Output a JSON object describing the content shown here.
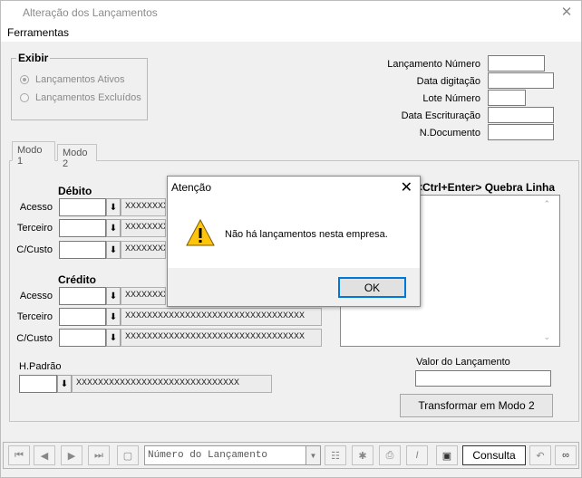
{
  "window": {
    "title": "Alteração dos Lançamentos",
    "close_glyph": "✕"
  },
  "menu": {
    "items": [
      "Ferramentas"
    ]
  },
  "exibir": {
    "legend": "Exibir",
    "options": [
      {
        "label": "Lançamentos Ativos",
        "checked": true
      },
      {
        "label": "Lançamentos Excluídos",
        "checked": false
      }
    ]
  },
  "header_fields": {
    "lancamento_numero": {
      "label": "Lançamento Número",
      "value": ""
    },
    "data_digitacao": {
      "label": "Data digitação",
      "value": ""
    },
    "lote_numero": {
      "label": "Lote Número",
      "value": ""
    },
    "data_escrituracao": {
      "label": "Data Escrituração",
      "value": ""
    },
    "n_documento": {
      "label": "N.Documento",
      "value": ""
    }
  },
  "tabs": [
    {
      "label": "Modo 1"
    },
    {
      "label": "Modo 2"
    }
  ],
  "debito": {
    "title": "Débito",
    "rows": [
      {
        "label": "Acesso",
        "text": "XXXXXXXXX"
      },
      {
        "label": "Terceiro",
        "text": "XXXXXXXXX"
      },
      {
        "label": "C/Custo",
        "text": "XXXXXXXXX"
      }
    ]
  },
  "credito": {
    "title": "Crédito",
    "rows": [
      {
        "label": "Acesso",
        "text": "XXXXXXXXX"
      },
      {
        "label": "Terceiro",
        "text": "XXXXXXXXXXXXXXXXXXXXXXXXXXXXXXXXX"
      },
      {
        "label": "C/Custo",
        "text": "XXXXXXXXXXXXXXXXXXXXXXXXXXXXXXXXX"
      }
    ]
  },
  "historico": {
    "hint": "<Ctrl+Enter> Quebra Linha"
  },
  "h_padrao": {
    "label": "H.Padrão",
    "text": "XXXXXXXXXXXXXXXXXXXXXXXXXXXXXX"
  },
  "valor": {
    "label": "Valor do Lançamento",
    "value": ""
  },
  "transform_button": "Transformar em  Modo 2",
  "toolbar": {
    "search_placeholder": "Número do Lançamento",
    "status": "Consulta"
  },
  "dialog": {
    "title": "Atenção",
    "message": "Não há lançamentos nesta empresa.",
    "ok_label": "OK",
    "icon": "warning-icon"
  }
}
